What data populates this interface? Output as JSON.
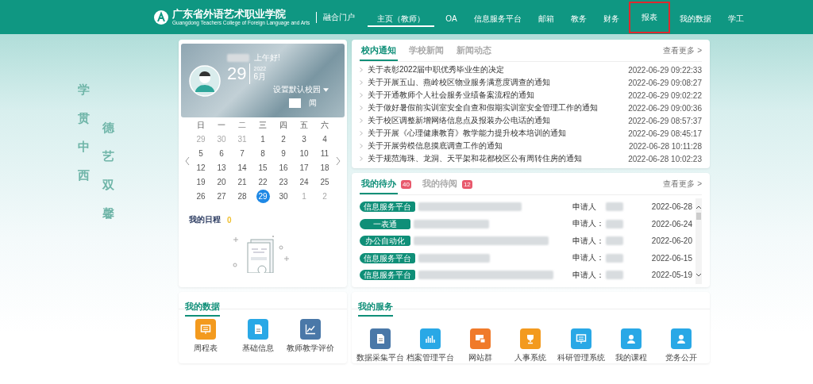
{
  "header": {
    "school_name": "广东省外语艺术职业学院",
    "school_subtitle": "Guangdong Teachers College of Foreign Language and Arts",
    "portal_name": "融合门户",
    "nav": [
      {
        "label": "主页（教师）",
        "selected": true,
        "highlighted": false
      },
      {
        "label": "OA",
        "selected": false,
        "highlighted": false
      },
      {
        "label": "信息服务平台",
        "selected": false,
        "highlighted": false
      },
      {
        "label": "邮箱",
        "selected": false,
        "highlighted": false
      },
      {
        "label": "教务",
        "selected": false,
        "highlighted": false
      },
      {
        "label": "财务",
        "selected": false,
        "highlighted": false
      },
      {
        "label": "报表",
        "selected": false,
        "highlighted": true
      },
      {
        "label": "我的数据",
        "selected": false,
        "highlighted": false
      },
      {
        "label": "学工",
        "selected": false,
        "highlighted": false
      }
    ]
  },
  "slogan": [
    "学贯中西",
    "德艺双馨"
  ],
  "profile": {
    "greeting": "上午好!",
    "day": "29",
    "year": "2022",
    "month": "6月",
    "campus_button": "设置默认校园",
    "weather": "闻"
  },
  "calendar": {
    "weekdays": [
      "日",
      "一",
      "二",
      "三",
      "四",
      "五",
      "六"
    ],
    "days": [
      {
        "day": "29",
        "muted": true,
        "selected": false
      },
      {
        "day": "30",
        "muted": true,
        "selected": false
      },
      {
        "day": "31",
        "muted": true,
        "selected": false
      },
      {
        "day": "1",
        "muted": false,
        "selected": false
      },
      {
        "day": "2",
        "muted": false,
        "selected": false
      },
      {
        "day": "3",
        "muted": false,
        "selected": false
      },
      {
        "day": "4",
        "muted": false,
        "selected": false
      },
      {
        "day": "5",
        "muted": false,
        "selected": false
      },
      {
        "day": "6",
        "muted": false,
        "selected": false
      },
      {
        "day": "7",
        "muted": false,
        "selected": false
      },
      {
        "day": "8",
        "muted": false,
        "selected": false
      },
      {
        "day": "9",
        "muted": false,
        "selected": false
      },
      {
        "day": "10",
        "muted": false,
        "selected": false
      },
      {
        "day": "11",
        "muted": false,
        "selected": false
      },
      {
        "day": "12",
        "muted": false,
        "selected": false
      },
      {
        "day": "13",
        "muted": false,
        "selected": false
      },
      {
        "day": "14",
        "muted": false,
        "selected": false
      },
      {
        "day": "15",
        "muted": false,
        "selected": false
      },
      {
        "day": "16",
        "muted": false,
        "selected": false
      },
      {
        "day": "17",
        "muted": false,
        "selected": false
      },
      {
        "day": "18",
        "muted": false,
        "selected": false
      },
      {
        "day": "19",
        "muted": false,
        "selected": false
      },
      {
        "day": "20",
        "muted": false,
        "selected": false
      },
      {
        "day": "21",
        "muted": false,
        "selected": false
      },
      {
        "day": "22",
        "muted": false,
        "selected": false
      },
      {
        "day": "23",
        "muted": false,
        "selected": false
      },
      {
        "day": "24",
        "muted": false,
        "selected": false
      },
      {
        "day": "25",
        "muted": false,
        "selected": false
      },
      {
        "day": "26",
        "muted": false,
        "selected": false
      },
      {
        "day": "27",
        "muted": false,
        "selected": false
      },
      {
        "day": "28",
        "muted": false,
        "selected": false
      },
      {
        "day": "29",
        "muted": false,
        "selected": true
      },
      {
        "day": "30",
        "muted": false,
        "selected": false
      },
      {
        "day": "1",
        "muted": true,
        "selected": false
      },
      {
        "day": "2",
        "muted": true,
        "selected": false
      }
    ]
  },
  "schedule": {
    "title": "我的日程",
    "count": "0"
  },
  "news": {
    "tabs": [
      {
        "label": "校内通知",
        "selected": true
      },
      {
        "label": "学校新闻",
        "selected": false
      },
      {
        "label": "新闻动态",
        "selected": false
      }
    ],
    "more": "查看更多 >",
    "items": [
      {
        "title": "关于表彰2022届中职优秀毕业生的决定",
        "time": "2022-06-29 09:22:33"
      },
      {
        "title": "关于开展五山、燕岭校区物业服务满意度调查的通知",
        "time": "2022-06-29 09:08:27"
      },
      {
        "title": "关于开通教师个人社会服务业绩备案流程的通知",
        "time": "2022-06-29 09:02:22"
      },
      {
        "title": "关于做好暑假前实训室安全自查和假期实训室安全管理工作的通知",
        "time": "2022-06-29 09:00:36"
      },
      {
        "title": "关于校区调整新增网络信息点及报装办公电话的通知",
        "time": "2022-06-29 08:57:37"
      },
      {
        "title": "关于开展《心理健康教育》教学能力提升校本培训的通知",
        "time": "2022-06-29 08:45:17"
      },
      {
        "title": "关于开展劳模信息摸底调查工作的通知",
        "time": "2022-06-28 10:11:28"
      },
      {
        "title": "关于规范海珠、龙洞、天平架和花都校区公有周转住房的通知",
        "time": "2022-06-28 10:02:23"
      }
    ]
  },
  "todo": {
    "tabs": [
      {
        "label": "我的待办",
        "badge": "40",
        "selected": true
      },
      {
        "label": "我的待阅",
        "badge": "12",
        "selected": false
      }
    ],
    "more": "查看更多 >",
    "items": [
      {
        "tag": "信息服务平台",
        "applicant_label": "申请人",
        "date": "2022-06-28"
      },
      {
        "tag": "一表通",
        "applicant_label": "申请人：",
        "date": "2022-06-24"
      },
      {
        "tag": "办公自动化",
        "applicant_label": "申请人：",
        "date": "2022-06-20"
      },
      {
        "tag": "信息服务平台",
        "applicant_label": "申请人：",
        "date": "2022-06-15"
      },
      {
        "tag": "信息服务平台",
        "applicant_label": "申请人：",
        "date": "2022-05-19"
      }
    ]
  },
  "my_data": {
    "title": "我的数据",
    "items": [
      {
        "label": "周程表",
        "kind": "board",
        "color": "#f39a1e"
      },
      {
        "label": "基础信息",
        "kind": "document",
        "color": "#29a8e6"
      },
      {
        "label": "教师教学评价",
        "kind": "line-chart",
        "color": "#4a78a8"
      }
    ]
  },
  "my_services": {
    "title": "我的服务",
    "items": [
      {
        "label": "数据采集平台",
        "kind": "document",
        "color": "#4a78a8"
      },
      {
        "label": "档案管理平台",
        "kind": "bars",
        "color": "#29a8e6"
      },
      {
        "label": "网站群",
        "kind": "monitor",
        "color": "#f07a2a"
      },
      {
        "label": "人事系统",
        "kind": "trophy",
        "color": "#f39a1e"
      },
      {
        "label": "科研管理系统",
        "kind": "board",
        "color": "#29a8e6"
      },
      {
        "label": "我的课程",
        "kind": "person",
        "color": "#29a8e6"
      },
      {
        "label": "党务公开",
        "kind": "person",
        "color": "#29a8e6"
      }
    ]
  }
}
